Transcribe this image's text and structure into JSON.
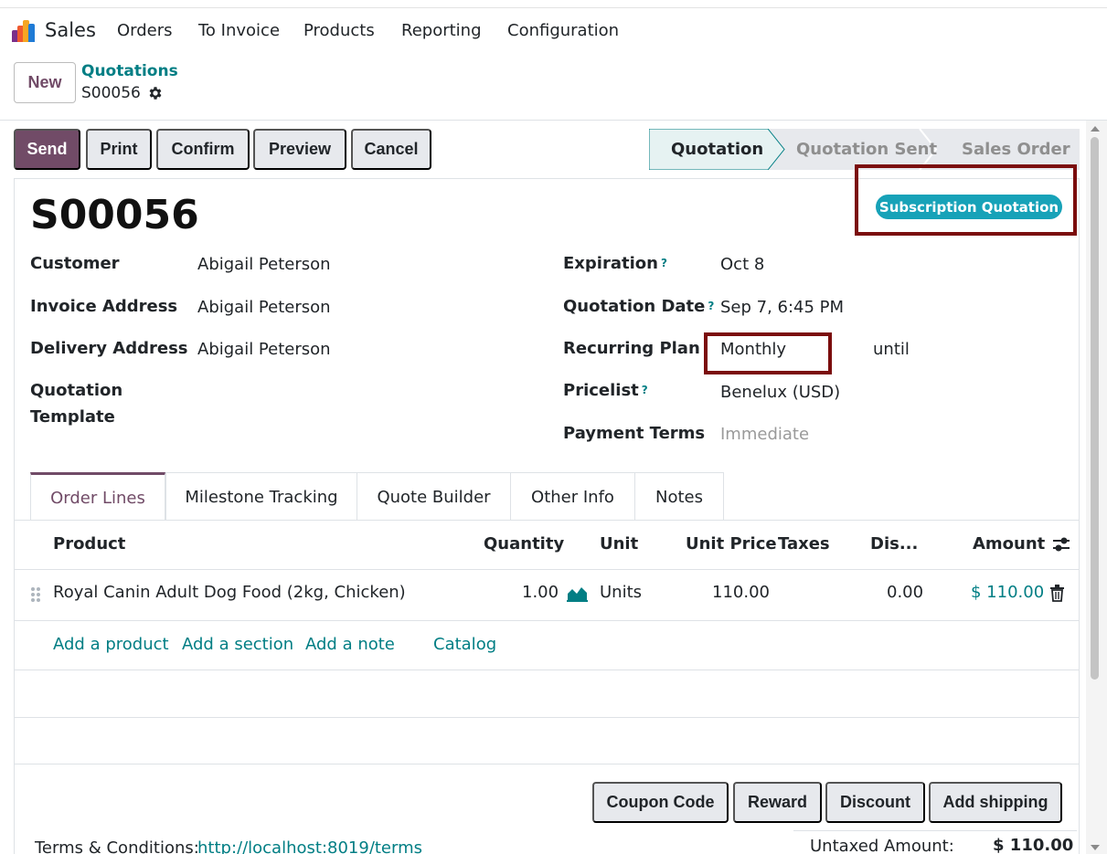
{
  "nav": {
    "app_name": "Sales",
    "menu": [
      "Orders",
      "To Invoice",
      "Products",
      "Reporting",
      "Configuration"
    ],
    "brand_colors": [
      "#7b2f8a",
      "#ef5a2f",
      "#f6a623",
      "#1f7bd6"
    ]
  },
  "control_panel": {
    "new_label": "New",
    "breadcrumb_parent": "Quotations",
    "breadcrumb_current": "S00056"
  },
  "actions": [
    "Send",
    "Print",
    "Confirm",
    "Preview",
    "Cancel"
  ],
  "status_steps": [
    "Quotation",
    "Quotation Sent",
    "Sales Order"
  ],
  "record": {
    "title": "S00056",
    "badge": "Subscription Quotation",
    "left_fields": [
      {
        "label": "Customer",
        "value": "Abigail Peterson"
      },
      {
        "label": "Invoice Address",
        "value": "Abigail Peterson"
      },
      {
        "label": "Delivery Address",
        "value": "Abigail Peterson"
      },
      {
        "label": "Quotation Template",
        "value": ""
      }
    ],
    "right_fields": [
      {
        "label": "Expiration",
        "help": "?",
        "value": "Oct 8"
      },
      {
        "label": "Quotation Date",
        "help": "?",
        "value": "Sep 7, 6:45 PM"
      },
      {
        "label": "Recurring Plan",
        "value": "Monthly",
        "extra": "until"
      },
      {
        "label": "Pricelist",
        "help": "?",
        "value": "Benelux (USD)"
      },
      {
        "label": "Payment Terms",
        "value": "Immediate"
      }
    ]
  },
  "tabs": [
    "Order Lines",
    "Milestone Tracking",
    "Quote Builder",
    "Other Info",
    "Notes"
  ],
  "order_table": {
    "headers": [
      "Product",
      "Quantity",
      "Unit",
      "Unit Price",
      "Taxes",
      "Dis...",
      "Amount"
    ],
    "rows": [
      {
        "product": "Royal Canin Adult Dog Food (2kg, Chicken)",
        "quantity": "1.00",
        "unit": "Units",
        "unit_price": "110.00",
        "taxes": "",
        "discount": "0.00",
        "amount": "$ 110.00"
      }
    ],
    "add_links": [
      "Add a product",
      "Add a section",
      "Add a note",
      "Catalog"
    ]
  },
  "bottom_buttons": [
    "Coupon Code",
    "Reward",
    "Discount",
    "Add shipping"
  ],
  "terms": {
    "label": "Terms & Conditions:",
    "link": "http://localhost:8019/terms"
  },
  "totals": {
    "untaxed_label": "Untaxed Amount:",
    "untaxed_value": "$ 110.00"
  },
  "colors": {
    "primary": "#714B67",
    "link": "#017e84",
    "badge": "#17a2b8",
    "highlight": "#7b0d0d"
  }
}
